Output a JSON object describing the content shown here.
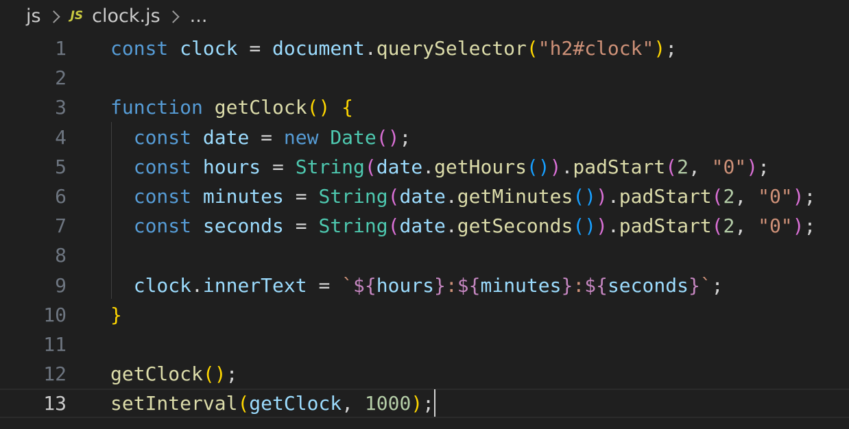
{
  "breadcrumb": {
    "folder": "js",
    "file_icon": "JS",
    "file": "clock.js",
    "more": "..."
  },
  "editor": {
    "current_line": 13,
    "lines": [
      {
        "number": "1",
        "text": "const clock = document.querySelector(\"h2#clock\");"
      },
      {
        "number": "2",
        "text": ""
      },
      {
        "number": "3",
        "text": "function getClock() {"
      },
      {
        "number": "4",
        "text": "  const date = new Date();"
      },
      {
        "number": "5",
        "text": "  const hours = String(date.getHours()).padStart(2, \"0\");"
      },
      {
        "number": "6",
        "text": "  const minutes = String(date.getMinutes()).padStart(2, \"0\");"
      },
      {
        "number": "7",
        "text": "  const seconds = String(date.getSeconds()).padStart(2, \"0\");"
      },
      {
        "number": "8",
        "text": ""
      },
      {
        "number": "9",
        "text": "  clock.innerText = `${hours}:${minutes}:${seconds}`;"
      },
      {
        "number": "10",
        "text": "}"
      },
      {
        "number": "11",
        "text": ""
      },
      {
        "number": "12",
        "text": "getClock();"
      },
      {
        "number": "13",
        "text": "setInterval(getClock, 1000);"
      }
    ]
  },
  "colors": {
    "background": "#1f1f1f",
    "keyword": "#569cd6",
    "variable": "#9cdcfe",
    "function": "#dcdcaa",
    "class": "#4ec9b0",
    "string": "#ce9178",
    "number": "#b5cea8",
    "bracket_level_1": "#ffd700",
    "bracket_level_2": "#da70d6",
    "bracket_level_3": "#179fff",
    "js_icon": "#cbcb41"
  }
}
